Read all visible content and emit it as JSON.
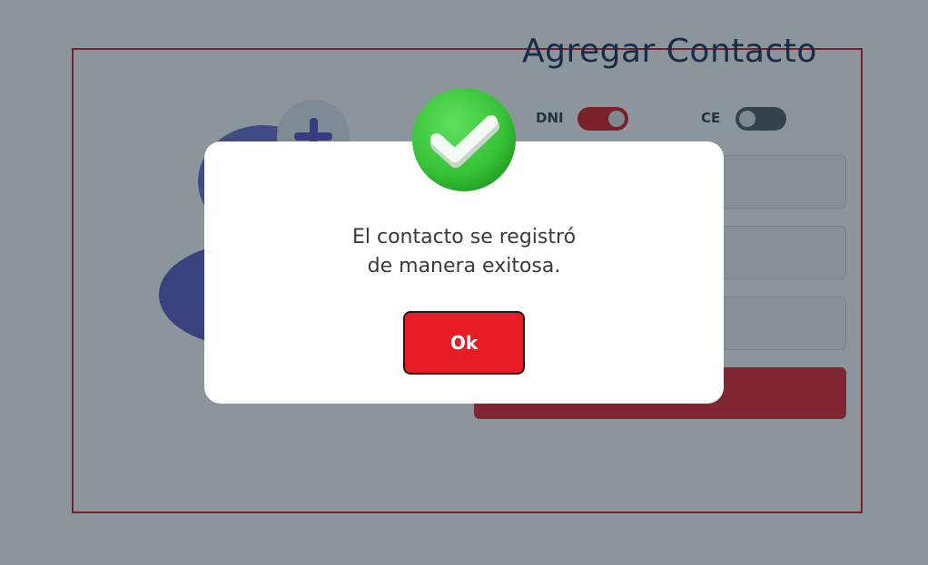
{
  "page": {
    "title": "Agregar Contacto",
    "document_types": [
      {
        "label": "DNI",
        "checked": true
      },
      {
        "label": "CE",
        "checked": false
      }
    ]
  },
  "modal": {
    "message_line1": "El contacto se registró",
    "message_line2": "de manera exitosa.",
    "ok_label": "Ok",
    "icon": "check-circle-icon"
  },
  "colors": {
    "accent_red": "#e81c24",
    "success_green": "#3cc23c",
    "title_navy": "#1d2a5b",
    "overlay": "rgba(24,44,56,0.5)"
  }
}
